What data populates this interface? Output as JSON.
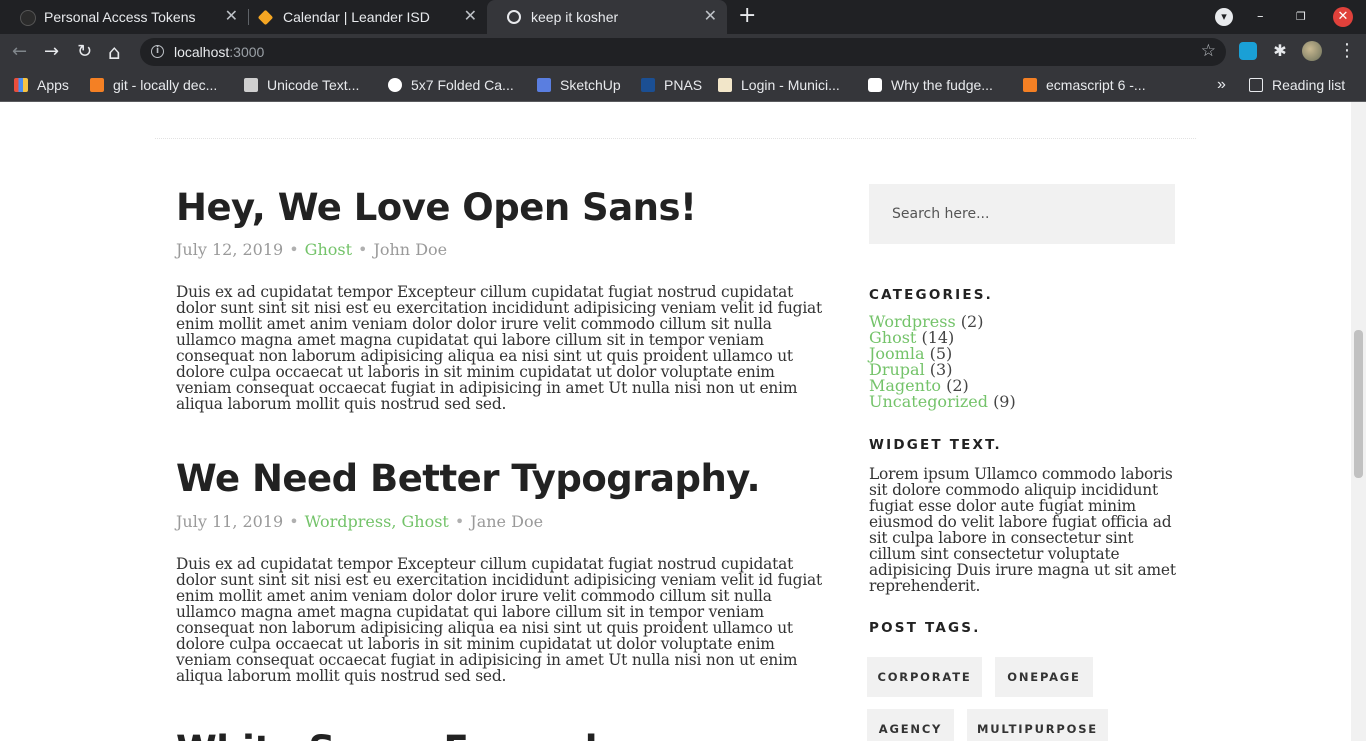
{
  "browser": {
    "tabs": [
      {
        "title": "Personal Access Tokens",
        "close": "✕"
      },
      {
        "title": "Calendar | Leander ISD",
        "close": "✕"
      },
      {
        "title": "keep it kosher",
        "close": "✕"
      }
    ],
    "new_tab": "+",
    "window_controls": {
      "dropdown": "▾",
      "minimize": "–",
      "restore": "❐",
      "close": "✕"
    },
    "nav": {
      "back": "←",
      "forward": "→",
      "reload": "↻",
      "home": "⌂"
    },
    "url_host": "localhost",
    "url_port": ":3000",
    "bookmark_star": "☆",
    "menu_dots": "⋮",
    "bookmarks": [
      {
        "label": "Apps",
        "color": "#e94e3c"
      },
      {
        "label": "git - locally dec...",
        "color": "#f48024"
      },
      {
        "label": "Unicode Text...",
        "color": "#cfcfcf"
      },
      {
        "label": "5x7 Folded Ca...",
        "color": "#ffffff"
      },
      {
        "label": "SketchUp",
        "color": "#5a7ee0"
      },
      {
        "label": "PNAS",
        "color": "#1b4f93"
      },
      {
        "label": "Login - Munici...",
        "color": "#f2e6c9"
      },
      {
        "label": "Why the fudge...",
        "color": "#ffffff"
      },
      {
        "label": "ecmascript 6 -...",
        "color": "#f48024"
      }
    ],
    "bookmarks_overflow": "»",
    "reading_list": "Reading list"
  },
  "posts": [
    {
      "title": "Hey, We Love Open Sans!",
      "date": "July 12, 2019",
      "categories": "Ghost",
      "author": "John Doe",
      "body": "Duis ex ad cupidatat tempor Excepteur cillum cupidatat fugiat nostrud cupidatat dolor sunt sint sit nisi est eu exercitation incididunt adipisicing veniam velit id fugiat enim mollit amet anim veniam dolor dolor irure velit commodo cillum sit nulla ullamco magna amet magna cupidatat qui labore cillum sit in tempor veniam consequat non laborum adipisicing aliqua ea nisi sint ut quis proident ullamco ut dolore culpa occaecat ut laboris in sit minim cupidatat ut dolor voluptate enim veniam consequat occaecat fugiat in adipisicing in amet Ut nulla nisi non ut enim aliqua laborum mollit quis nostrud sed sed."
    },
    {
      "title": "We Need Better Typography.",
      "date": "July 11, 2019",
      "categories": "Wordpress, Ghost",
      "author": "Jane Doe",
      "body": "Duis ex ad cupidatat tempor Excepteur cillum cupidatat fugiat nostrud cupidatat dolor sunt sint sit nisi est eu exercitation incididunt adipisicing veniam velit id fugiat enim mollit amet anim veniam dolor dolor irure velit commodo cillum sit nulla ullamco magna amet magna cupidatat qui labore cillum sit in tempor veniam consequat non laborum adipisicing aliqua ea nisi sint ut quis proident ullamco ut dolore culpa occaecat ut laboris in sit minim cupidatat ut dolor voluptate enim veniam consequat occaecat fugiat in adipisicing in amet Ut nulla nisi non ut enim aliqua laborum mollit quis nostrud sed sed."
    },
    {
      "title": "White Space Far and"
    }
  ],
  "meta_separator": "•",
  "sidebar": {
    "search_placeholder": "Search here...",
    "categories_title": "CATEGORIES.",
    "categories": [
      {
        "name": "Wordpress",
        "count": "(2)"
      },
      {
        "name": "Ghost",
        "count": "(14)"
      },
      {
        "name": "Joomla",
        "count": "(5)"
      },
      {
        "name": "Drupal",
        "count": "(3)"
      },
      {
        "name": "Magento",
        "count": "(2)"
      },
      {
        "name": "Uncategorized",
        "count": "(9)"
      }
    ],
    "widget_text_title": "WIDGET TEXT.",
    "widget_text": "Lorem ipsum Ullamco commodo laboris sit dolore commodo aliquip incididunt fugiat esse dolor aute fugiat minim eiusmod do velit labore fugiat officia ad sit culpa labore in consectetur sint cillum sint consectetur voluptate adipisicing Duis irure magna ut sit amet reprehenderit.",
    "tags_title": "POST TAGS.",
    "tags": [
      "CORPORATE",
      "ONEPAGE",
      "AGENCY",
      "MULTIPURPOSE"
    ]
  },
  "colors": {
    "accent": "#74c36a",
    "chrome_dark": "#202124",
    "chrome": "#35363a"
  }
}
